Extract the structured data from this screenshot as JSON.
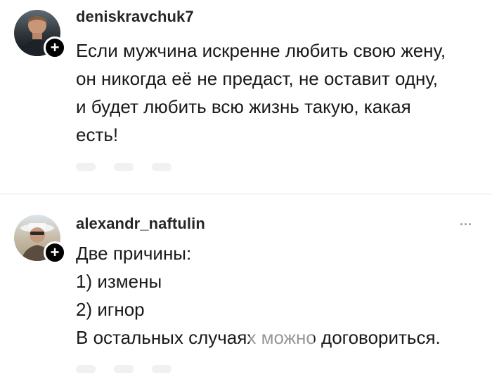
{
  "comments": [
    {
      "username": "deniskravchuk7",
      "lines": [
        "Если мужчина искренне любить свою жену,",
        "он никогда её не предаст, не оставит одну,",
        "и будет любить всю жизнь такую, какая",
        "есть!"
      ],
      "avatar_icon": "user-avatar",
      "follow_badge": "+"
    },
    {
      "username": "alexandr_naftulin",
      "lines": [
        "Две причины:",
        "1) измены",
        "2) игнор",
        "В остальных случаях можно договориться."
      ],
      "avatar_icon": "user-avatar",
      "follow_badge": "+",
      "more_label": "..."
    }
  ],
  "colors": {
    "text": "#1a1a1a",
    "username": "#262626",
    "divider": "#e6e6e6",
    "badge": "#000000"
  }
}
